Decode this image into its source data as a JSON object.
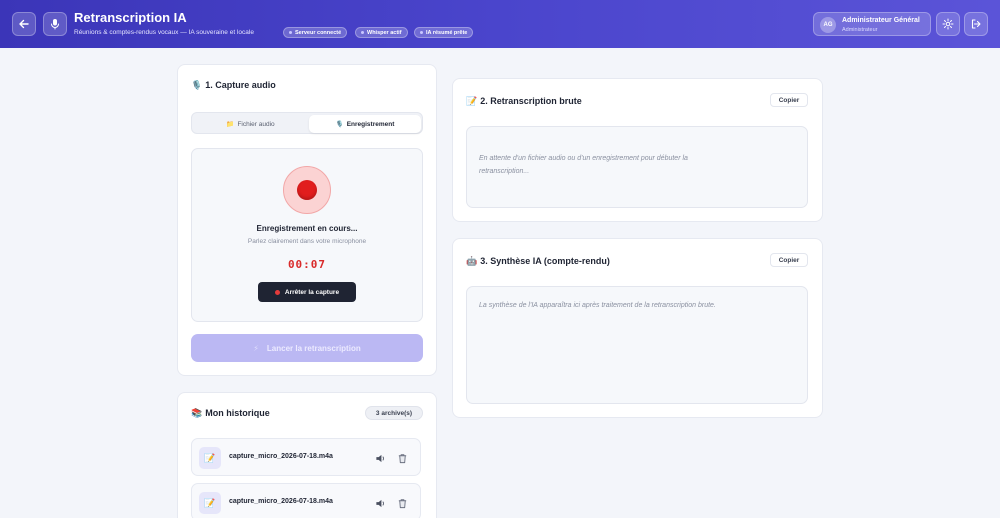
{
  "header": {
    "title": "Retranscription IA",
    "subtitle": "Réunions & comptes-rendus vocaux — IA souveraine et locale",
    "status_pills": [
      "Serveur connecté",
      "Whisper actif",
      "IA résumé prête"
    ],
    "user": {
      "initials": "AG",
      "name": "Administrateur Général",
      "role": "Administrateur"
    },
    "icons": [
      "back-arrow-icon",
      "microphone-icon",
      "gear-icon",
      "logout-icon"
    ]
  },
  "capture": {
    "emoji": "🎙️",
    "title": "1. Capture audio",
    "tabs": [
      {
        "emoji": "📁",
        "label": "Fichier audio",
        "active": false
      },
      {
        "emoji": "🎙️",
        "label": "Enregistrement",
        "active": true
      }
    ],
    "recording": {
      "status": "Enregistrement en cours...",
      "hint": "Parlez clairement dans votre microphone",
      "timer": "00:07",
      "stop_label": "Arrêter la capture"
    },
    "launch": {
      "emoji": "⚡",
      "label": "Lancer la retranscription"
    }
  },
  "history": {
    "emoji": "📚",
    "title": "Mon historique",
    "badge": "3 archive(s)",
    "items": [
      {
        "emoji": "📝",
        "name": "capture_micro_2026-07-18.m4a"
      },
      {
        "emoji": "📝",
        "name": "capture_micro_2026-07-18.m4a"
      }
    ]
  },
  "raw": {
    "emoji": "📝",
    "title": "2. Retranscription brute",
    "copy_label": "Copier",
    "placeholder_line1": "En attente d'un fichier audio ou d'un enregistrement pour débuter la",
    "placeholder_line2": "retranscription..."
  },
  "synthesis": {
    "emoji": "🤖",
    "title": "3. Synthèse IA (compte-rendu)",
    "copy_label": "Copier",
    "placeholder": "La synthèse de l'IA apparaîtra ici après traitement de la retranscription brute."
  },
  "colors": {
    "header_start": "#3b35b8",
    "header_end": "#5b54d8",
    "record_red": "#e11d1d",
    "timer_red": "#d92b2b",
    "launch_disabled": "#bbb8f3",
    "dark_button": "#1f2433"
  }
}
